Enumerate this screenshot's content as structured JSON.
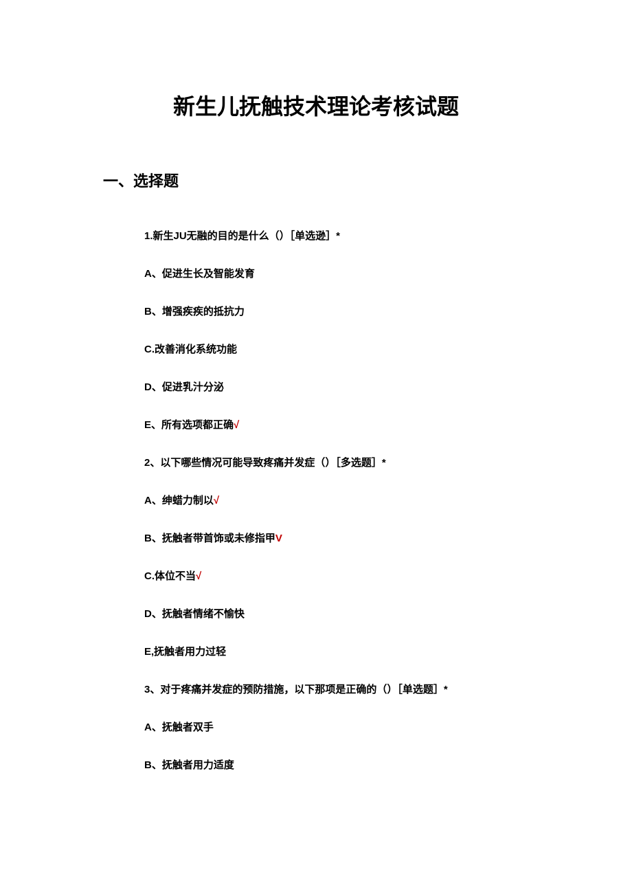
{
  "title": "新生儿抚触技术理论考核试题",
  "section": "一、选择题",
  "lines": [
    {
      "prefix": "1.新生JU无融的目的是什么（）［单选逊］*",
      "check": ""
    },
    {
      "prefix": "A、促进生长及智能发育",
      "check": ""
    },
    {
      "prefix": "B、增强疾疾的抵抗力",
      "check": ""
    },
    {
      "prefix": "C.改善消化系统功能",
      "check": ""
    },
    {
      "prefix": "D、促进乳汁分泌",
      "check": ""
    },
    {
      "prefix": "E、所有选项都正确",
      "check": "√"
    },
    {
      "prefix": "2、以下哪些情况可能导致疼痛并发症（）［多选题］*",
      "check": ""
    },
    {
      "prefix": "A、绅蜡力制以",
      "check": "√"
    },
    {
      "prefix": "B、抚触者带首饰或未修指甲",
      "check": "V"
    },
    {
      "prefix": "C.体位不当",
      "check": "√"
    },
    {
      "prefix": "D、抚触者情绪不愉快",
      "check": ""
    },
    {
      "prefix": "E,抚触者用力过轻",
      "check": ""
    },
    {
      "prefix": "3、对于疼痛并发症的预防措施，以下那项是正确的（）［单选题］*",
      "check": ""
    },
    {
      "prefix": "A、抚触者双手",
      "check": ""
    },
    {
      "prefix": "B、抚触者用力适度",
      "check": ""
    }
  ]
}
